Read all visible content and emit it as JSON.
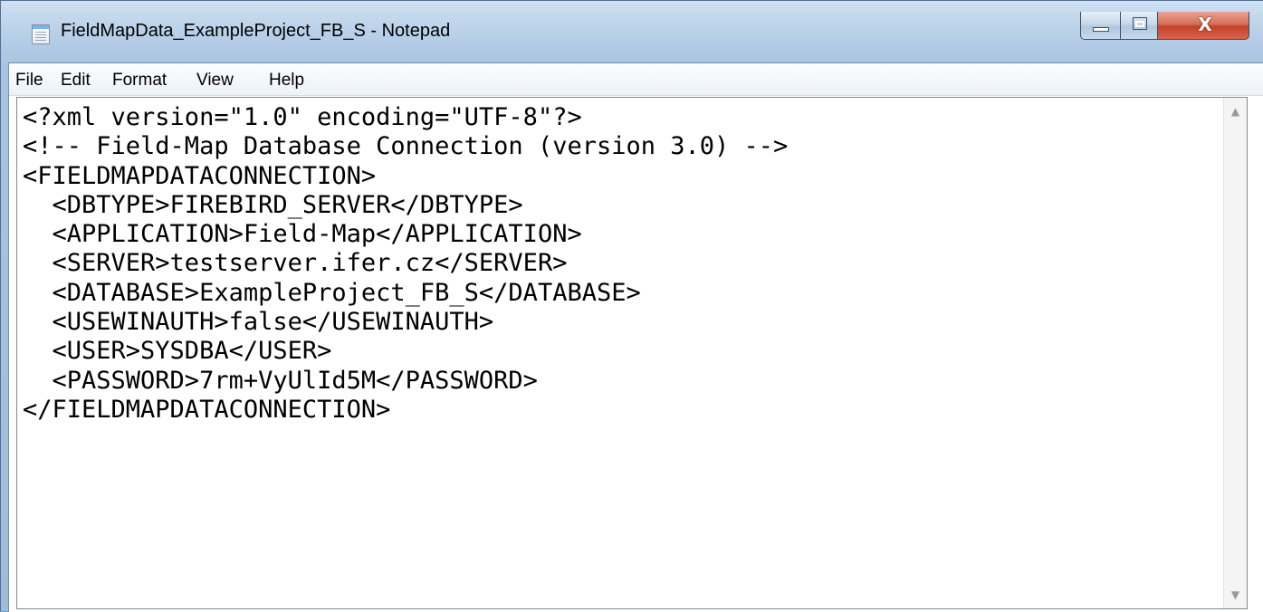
{
  "window": {
    "title": "FieldMapData_ExampleProject_FB_S - Notepad",
    "app_icon": "notepad-icon",
    "caption_buttons": {
      "minimize_icon": "minimize-icon",
      "maximize_icon": "maximize-icon",
      "close_glyph": "X",
      "close_color": "#c4412a"
    }
  },
  "menu": {
    "items": [
      {
        "label": "File"
      },
      {
        "label": "Edit"
      },
      {
        "label": "Format"
      },
      {
        "label": "View"
      },
      {
        "label": "Help"
      }
    ]
  },
  "editor": {
    "lines": [
      "<?xml version=\"1.0\" encoding=\"UTF-8\"?>",
      "<!-- Field-Map Database Connection (version 3.0) -->",
      "<FIELDMAPDATACONNECTION>",
      "  <DBTYPE>FIREBIRD_SERVER</DBTYPE>",
      "  <APPLICATION>Field-Map</APPLICATION>",
      "  <SERVER>testserver.ifer.cz</SERVER>",
      "  <DATABASE>ExampleProject_FB_S</DATABASE>",
      "  <USEWINAUTH>false</USEWINAUTH>",
      "  <USER>SYSDBA</USER>",
      "  <PASSWORD>7rm+VyUlId5M</PASSWORD>",
      "</FIELDMAPDATACONNECTION>"
    ],
    "scrollbar": {
      "up_icon": "scroll-up-arrow-icon",
      "down_icon": "scroll-down-arrow-icon"
    }
  }
}
